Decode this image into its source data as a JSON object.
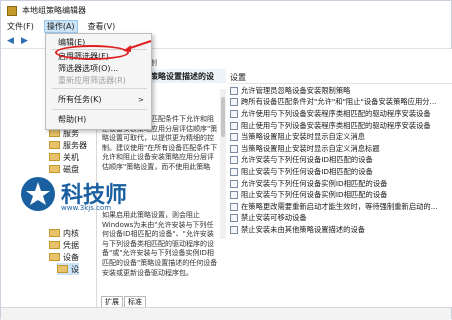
{
  "window": {
    "title": "本地组策略编辑器"
  },
  "menubar": {
    "file": "文件(F)",
    "action": "操作(A)",
    "view": "查看(V)"
  },
  "menu": {
    "items": [
      {
        "label": "编辑(E)",
        "disabled": false
      },
      {
        "label": "启用筛选器(F)",
        "disabled": false
      },
      {
        "label": "筛选器选项(O)...",
        "disabled": false
      },
      {
        "label": "重新应用筛选器(R)",
        "disabled": true
      },
      {
        "label": "所有任务(K)",
        "disabled": false,
        "submenu": ">"
      },
      {
        "label": "帮助(H)",
        "disabled": false
      }
    ]
  },
  "tree": {
    "items": [
      "服务",
      "服务器",
      "关机",
      "磁盘",
      "内核",
      "凭据",
      "设备",
      "设"
    ]
  },
  "desc": {
    "header": "策略设置描述的设",
    "heading_fragment": "制",
    "body": "规则在所有设备匹配条件下允许和阻止设备安装策略应用分层评估顺序\"策略设置可取代，以提供更为精细的控制。建议使用\"在所有设备匹配条件下允许和阻止设备安装策略应用分层评估顺序\"策略设置，而不使用此策略",
    "body2": "如果启用此策略设置，则会阻止Windows为未由\"允许安装与下列任何设备ID相匹配的设备\"、\"允许安装与下列设备类相匹配的驱动程序的设备\"或\"允许安装与下列设备实例ID相匹配的设备\"策略设置描述的任何设备安装或更新设备驱动程序包。"
  },
  "list": {
    "column": "设置",
    "rows": [
      "允许管理员忽略设备安装限制策略",
      "跨所有设备匹配条件对\"允许\"和\"阻止\"设备安装策略应用分...",
      "允许使用与下列设备安装程序类相匹配的驱动程序安装设备",
      "阻止使用与下列设备安装程序类相匹配的驱动程序安装设备",
      "当策略设置阻止安装时显示自定义消息",
      "当策略设置阻止安装时显示自定义消息标题",
      "允许安装与下列任何设备ID相匹配的设备",
      "阻止安装与下列任何设备ID相匹配的设备",
      "允许安装与下列任何设备实例ID相匹配的设备",
      "阻止安装与下列任何设备实例ID相匹配的设备",
      "在策略更改需要重新启动才能生效时，等待强制重新启动的...",
      "禁止安装可移动设备",
      "禁止安装未由其他策略设置描述的设备"
    ]
  },
  "tabs": {
    "extended": "扩展",
    "standard": "标准"
  },
  "watermark": {
    "name": "科技师",
    "url": "www.3kjs.com"
  },
  "colors": {
    "accent": "#1a5fa0",
    "highlight": "#e02020",
    "menu_active": "#cce4f7"
  }
}
